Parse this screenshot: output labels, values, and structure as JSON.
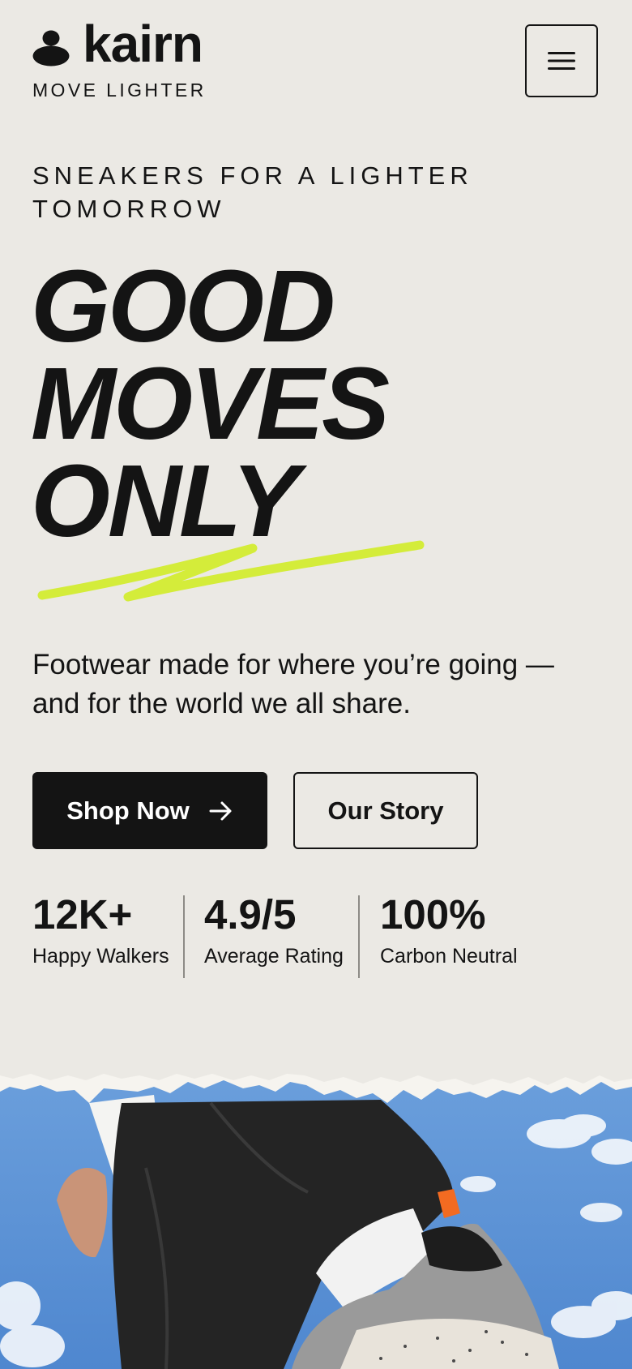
{
  "brand": {
    "name": "kairn",
    "tagline": "MOVE LIGHTER",
    "logo_icon": "stacked-stones-icon"
  },
  "header": {
    "menu_icon": "hamburger-menu-icon"
  },
  "hero": {
    "eyebrow": "SNEAKERS FOR A LIGHTER TOMORROW",
    "headline": [
      "GOOD",
      "MOVES",
      "ONLY"
    ],
    "lede": "Footwear made for where you’re going — and for the world we all share.",
    "primary_cta": "Shop Now",
    "primary_cta_icon": "arrow-right-icon",
    "secondary_cta": "Our Story"
  },
  "stats": [
    {
      "value": "12K+",
      "label": "Happy Walkers"
    },
    {
      "value": "4.9/5",
      "label": "Average Rating"
    },
    {
      "value": "100%",
      "label": "Carbon Neutral"
    }
  ],
  "colors": {
    "background": "#ebe9e4",
    "ink": "#141414",
    "accent": "#d4ec3a",
    "sky": "#5b93d6"
  }
}
